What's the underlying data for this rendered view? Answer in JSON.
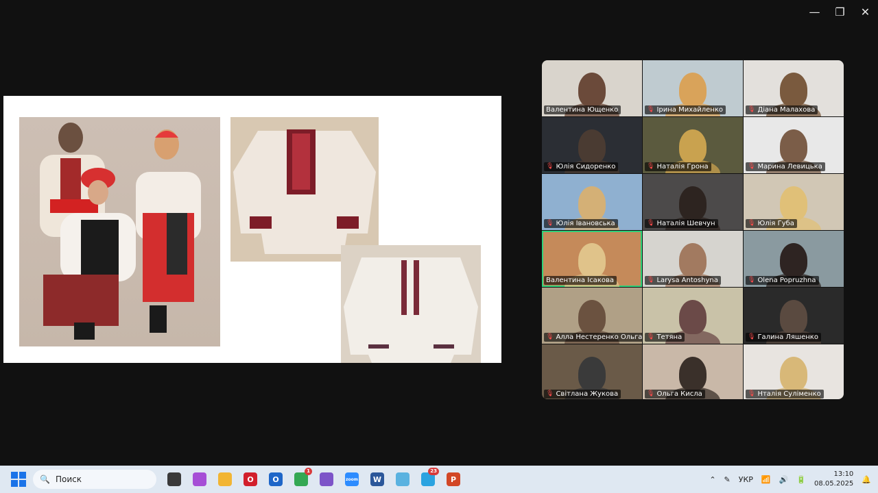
{
  "window": {
    "minimize": "—",
    "restore": "❐",
    "close": "✕"
  },
  "participants": [
    {
      "name": "Валентина Ющенко",
      "muted": false,
      "bg": "#d9d4cc",
      "face": "#6b4a3a"
    },
    {
      "name": "Ірина Михайленко",
      "muted": true,
      "bg": "#bfcbd0",
      "face": "#d9a35a"
    },
    {
      "name": "Діана Малахова",
      "muted": true,
      "bg": "#e3e0dc",
      "face": "#7a5a3e"
    },
    {
      "name": "Юлія Сидоренко",
      "muted": true,
      "bg": "#2b2e34",
      "face": "#4a3b32"
    },
    {
      "name": "Наталія Грона",
      "muted": true,
      "bg": "#5b5a3e",
      "face": "#c9a24f"
    },
    {
      "name": "Марина Левицька",
      "muted": true,
      "bg": "#e8e8e8",
      "face": "#7b5d48"
    },
    {
      "name": "Юлія Івановська",
      "muted": true,
      "bg": "#8fb0d0",
      "face": "#d4b076"
    },
    {
      "name": "Наталія Шевчун",
      "muted": true,
      "bg": "#4c4a4a",
      "face": "#2d2420"
    },
    {
      "name": "Юлія Губа",
      "muted": true,
      "bg": "#d1c7b5",
      "face": "#e0c078"
    },
    {
      "name": "Валентина Ісакова",
      "muted": false,
      "active": true,
      "bg": "#c58a5a",
      "face": "#e0c38a"
    },
    {
      "name": "Larysa Antoshyna",
      "muted": true,
      "bg": "#d6d4cf",
      "face": "#a27a60"
    },
    {
      "name": "Olena Popruzhna",
      "muted": true,
      "bg": "#8a9aa0",
      "face": "#2e2422"
    },
    {
      "name": "Алла Нестеренко Ольга Гуль",
      "muted": true,
      "bg": "#b0a086",
      "face": "#6b5240"
    },
    {
      "name": "Тетяна",
      "muted": true,
      "bg": "#c9c2a8",
      "face": "#6b4a48"
    },
    {
      "name": "Галина Ляшенко",
      "muted": true,
      "bg": "#2a2a2a",
      "face": "#5a4a40"
    },
    {
      "name": "Світлана Жукова",
      "muted": true,
      "bg": "#6a5a48",
      "face": "#3a3a3a"
    },
    {
      "name": "Ольга Кисла",
      "muted": true,
      "bg": "#c9b8a8",
      "face": "#3a302a"
    },
    {
      "name": "Нталія Суліменко",
      "muted": true,
      "bg": "#e8e4e0",
      "face": "#d8b878"
    }
  ],
  "taskbar": {
    "search_placeholder": "Поиск",
    "apps": [
      {
        "name": "task-view-icon",
        "color": "#3a3a3a",
        "glyph": ""
      },
      {
        "name": "copilot-icon",
        "color": "#a64fd6",
        "glyph": ""
      },
      {
        "name": "file-explorer-icon",
        "color": "#f2b533",
        "glyph": ""
      },
      {
        "name": "opera-icon",
        "color": "#d21f2b",
        "glyph": "O"
      },
      {
        "name": "outlook-icon",
        "color": "#1e66c8",
        "glyph": "O"
      },
      {
        "name": "chrome-icon",
        "color": "#34a853",
        "glyph": "",
        "badge": "1"
      },
      {
        "name": "viber-icon",
        "color": "#7d54c8",
        "glyph": ""
      },
      {
        "name": "zoom-icon",
        "color": "#2d8cff",
        "glyph": "zoom"
      },
      {
        "name": "word-icon",
        "color": "#2b579a",
        "glyph": "W"
      },
      {
        "name": "send-icon",
        "color": "#5ab2e0",
        "glyph": ""
      },
      {
        "name": "telegram-icon",
        "color": "#2aa3e0",
        "glyph": "",
        "badge": "23"
      },
      {
        "name": "powerpoint-icon",
        "color": "#d24726",
        "glyph": "P"
      }
    ],
    "language": "УКР",
    "time": "13:10",
    "date": "08.05.2025"
  }
}
